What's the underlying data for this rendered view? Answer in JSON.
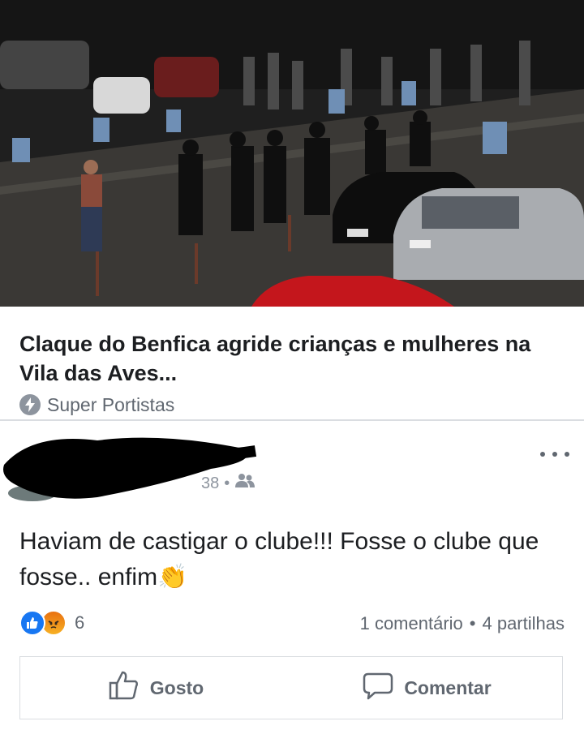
{
  "link_preview": {
    "title": "Claque do Benfica agride crianças e mulheres na Vila das Aves...",
    "source": "Super Portistas",
    "source_icon": "lightning-bolt-icon"
  },
  "post": {
    "meta_fragment": "38",
    "meta_separator": "•",
    "privacy_icon": "friends-icon",
    "text": "Haviam de castigar o clube!!! Fosse o clube que fosse.. enfim👏"
  },
  "reactions": {
    "types": [
      "like",
      "angry"
    ],
    "count": "6"
  },
  "stats": {
    "comments": "1 comentário",
    "separator": "•",
    "shares": "4 partilhas"
  },
  "actions": {
    "like_label": "Gosto",
    "comment_label": "Comentar"
  },
  "colors": {
    "like_blue": "#1877f2",
    "muted_text": "#606770",
    "border": "#dadde1"
  }
}
